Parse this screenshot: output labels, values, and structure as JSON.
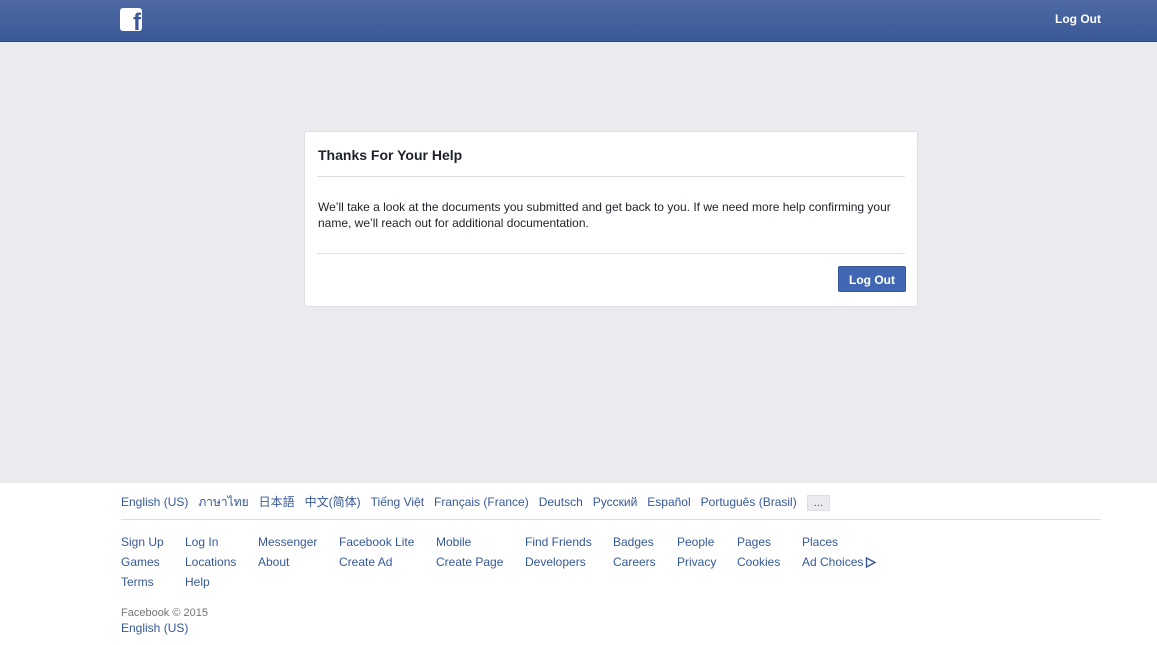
{
  "header": {
    "logo_text": "f",
    "logout_label": "Log Out",
    "color": "#3b5998"
  },
  "dialog": {
    "title": "Thanks For Your Help",
    "body": "We’ll take a look at the documents you submitted and get back to you. If we need more help confirming your name, we’ll reach out for additional documentation.",
    "button_label": "Log Out"
  },
  "footer": {
    "languages": [
      "English (US)",
      "ภาษาไทย",
      "日本語",
      "中文(简体)",
      "Tiếng Việt",
      "Français (France)",
      "Deutsch",
      "Русский",
      "Español",
      "Português (Brasil)"
    ],
    "more_label": "...",
    "links": {
      "sign_up": "Sign Up",
      "log_in": "Log In",
      "messenger": "Messenger",
      "facebook_lite": "Facebook Lite",
      "mobile": "Mobile",
      "find_friends": "Find Friends",
      "badges": "Badges",
      "people": "People",
      "pages": "Pages",
      "places": "Places",
      "games": "Games",
      "locations": "Locations",
      "about": "About",
      "create_ad": "Create Ad",
      "create_page": "Create Page",
      "developers": "Developers",
      "careers": "Careers",
      "privacy": "Privacy",
      "cookies": "Cookies",
      "ad_choices": "Ad Choices",
      "terms": "Terms",
      "help": "Help"
    },
    "copyright": "Facebook © 2015",
    "current_language": "English (US)"
  }
}
